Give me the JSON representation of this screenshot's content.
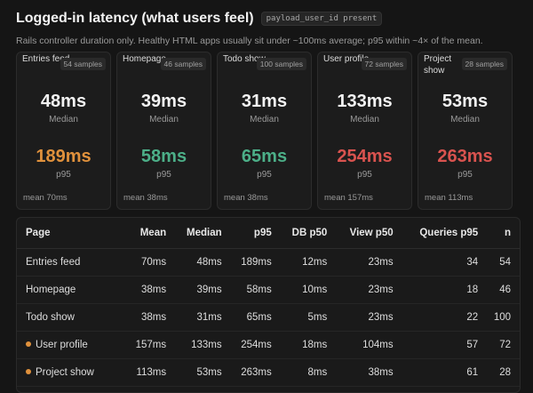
{
  "header": {
    "title": "Logged-in latency (what users feel)",
    "badge": "payload_user_id present",
    "subtitle": "Rails controller duration only. Healthy HTML apps usually sit under ~100ms average; p95 within ~4× of the mean."
  },
  "colors": {
    "warn": "#e0913c",
    "good": "#4caf88",
    "bad": "#d9534f"
  },
  "cards": [
    {
      "name": "Entries feed",
      "samples": "54 samples",
      "median": "48ms",
      "median_label": "Median",
      "p95": "189ms",
      "p95_label": "p95",
      "status": "warn",
      "mean": "mean 70ms"
    },
    {
      "name": "Homepage",
      "samples": "46 samples",
      "median": "39ms",
      "median_label": "Median",
      "p95": "58ms",
      "p95_label": "p95",
      "status": "good",
      "mean": "mean 38ms"
    },
    {
      "name": "Todo show",
      "samples": "100 samples",
      "median": "31ms",
      "median_label": "Median",
      "p95": "65ms",
      "p95_label": "p95",
      "status": "good",
      "mean": "mean 38ms"
    },
    {
      "name": "User profile",
      "samples": "72 samples",
      "median": "133ms",
      "median_label": "Median",
      "p95": "254ms",
      "p95_label": "p95",
      "status": "bad",
      "mean": "mean 157ms"
    },
    {
      "name": "Project show",
      "samples": "28 samples",
      "median": "53ms",
      "median_label": "Median",
      "p95": "263ms",
      "p95_label": "p95",
      "status": "bad",
      "mean": "mean 113ms"
    }
  ],
  "table": {
    "columns": [
      "Page",
      "Mean",
      "Median",
      "p95",
      "DB p50",
      "View p50",
      "Queries p95",
      "n"
    ],
    "rows": [
      {
        "flag": false,
        "cells": [
          "Entries feed",
          "70ms",
          "48ms",
          "189ms",
          "12ms",
          "23ms",
          "34",
          "54"
        ]
      },
      {
        "flag": false,
        "cells": [
          "Homepage",
          "38ms",
          "39ms",
          "58ms",
          "10ms",
          "23ms",
          "18",
          "46"
        ]
      },
      {
        "flag": false,
        "cells": [
          "Todo show",
          "38ms",
          "31ms",
          "65ms",
          "5ms",
          "23ms",
          "22",
          "100"
        ]
      },
      {
        "flag": true,
        "cells": [
          "User profile",
          "157ms",
          "133ms",
          "254ms",
          "18ms",
          "104ms",
          "57",
          "72"
        ]
      },
      {
        "flag": true,
        "cells": [
          "Project show",
          "113ms",
          "53ms",
          "263ms",
          "8ms",
          "38ms",
          "61",
          "28"
        ]
      }
    ]
  }
}
